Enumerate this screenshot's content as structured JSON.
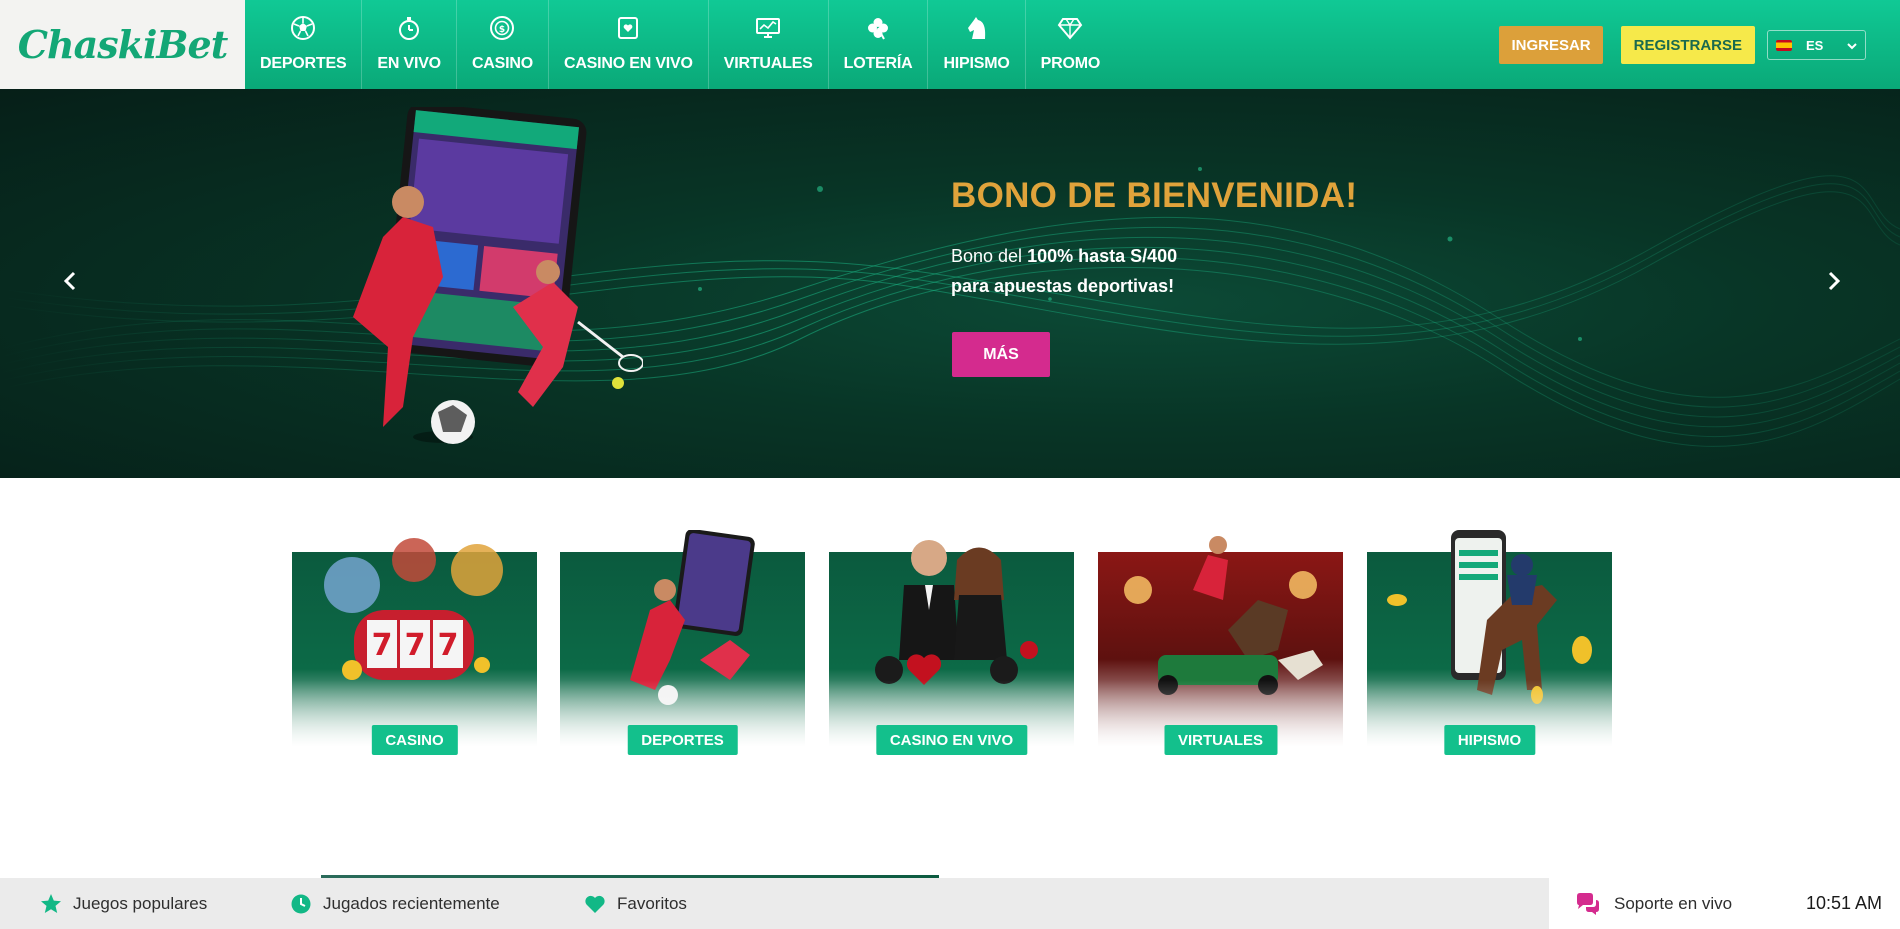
{
  "logo": {
    "text": "ChaskiBet"
  },
  "nav": {
    "items": [
      {
        "label": "DEPORTES",
        "icon": "soccer-ball-icon"
      },
      {
        "label": "EN VIVO",
        "icon": "stopwatch-icon"
      },
      {
        "label": "CASINO",
        "icon": "casino-chip-icon"
      },
      {
        "label": "CASINO EN VIVO",
        "icon": "card-heart-icon"
      },
      {
        "label": "VIRTUALES",
        "icon": "monitor-chart-icon"
      },
      {
        "label": "LOTERÍA",
        "icon": "clover-icon"
      },
      {
        "label": "HIPISMO",
        "icon": "horse-head-icon"
      },
      {
        "label": "PROMO",
        "icon": "diamond-icon"
      }
    ]
  },
  "header": {
    "login_label": "INGRESAR",
    "register_label": "REGISTRARSE",
    "language": "ES"
  },
  "hero": {
    "title": "BONO DE BIENVENIDA!",
    "line1_prefix": "Bono del ",
    "line1_bold": "100% hasta S/400",
    "line2": "para apuestas deportivas!",
    "cta_label": "MÁS"
  },
  "categories": [
    {
      "label": "CASINO"
    },
    {
      "label": "DEPORTES"
    },
    {
      "label": "CASINO EN VIVO"
    },
    {
      "label": "VIRTUALES"
    },
    {
      "label": "HIPISMO"
    }
  ],
  "bottom": {
    "popular": "Juegos populares",
    "recent": "Jugados recientemente",
    "favorites": "Favoritos",
    "support": "Soporte en vivo",
    "time": "10:51 AM"
  },
  "colors": {
    "header_green": "#10c995",
    "accent_gold": "#dca03a",
    "accent_yellow": "#f6e94a",
    "cta_pink": "#d42b8e",
    "card_button": "#13c08c"
  }
}
